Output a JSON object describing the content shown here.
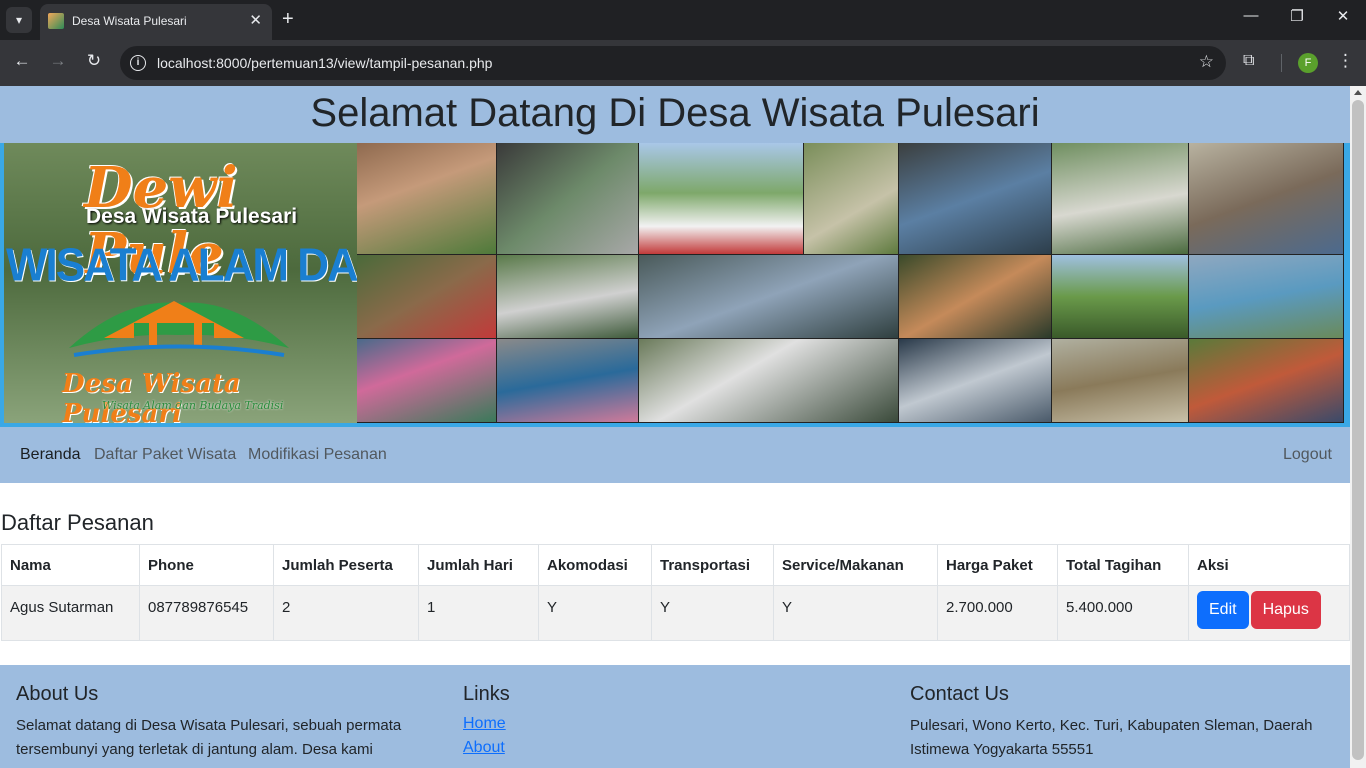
{
  "browser": {
    "tab_title": "Desa Wisata Pulesari",
    "tab_close": "✕",
    "new_tab": "+",
    "url": "localhost:8000/pertemuan13/view/tampil-pesanan.php",
    "profile_initial": "F",
    "icons": {
      "tab_menu": "chevron-down-icon",
      "back": "back-arrow-icon",
      "forward": "forward-arrow-icon",
      "reload": "reload-icon",
      "site_info": "info-icon",
      "bookmark": "star-icon",
      "extensions": "puzzle-icon",
      "menu": "kebab-icon",
      "minimize": "minimize-icon",
      "maximize": "restore-icon",
      "close": "close-icon"
    }
  },
  "page": {
    "title": "Selamat Datang Di Desa Wisata Pulesari",
    "banner": {
      "logo_script": "Dewi Pule",
      "logo_subtitle": "Desa Wisata Pulesari",
      "logo_banner": "WISATA ALAM DAN BUDAYA TRADISI",
      "logo_name": "Desa Wisata Pulesari",
      "logo_tagline": "Wisata Alam dan Budaya Tradisi"
    },
    "nav": {
      "items": [
        "Beranda",
        "Daftar Paket Wisata",
        "Modifikasi Pesanan"
      ],
      "logout": "Logout"
    },
    "orders": {
      "title": "Daftar Pesanan",
      "columns": [
        "Nama",
        "Phone",
        "Jumlah Peserta",
        "Jumlah Hari",
        "Akomodasi",
        "Transportasi",
        "Service/Makanan",
        "Harga Paket",
        "Total Tagihan",
        "Aksi"
      ],
      "rows": [
        {
          "nama": "Agus Sutarman",
          "phone": "087789876545",
          "jumlah_peserta": "2",
          "jumlah_hari": "1",
          "akomodasi": "Y",
          "transportasi": "Y",
          "service_makanan": "Y",
          "harga_paket": "2.700.000",
          "total_tagihan": "5.400.000",
          "edit_label": "Edit",
          "delete_label": "Hapus"
        }
      ]
    },
    "footer": {
      "about_title": "About Us",
      "about_text": "Selamat datang di Desa Wisata Pulesari, sebuah permata tersembunyi yang terletak di jantung alam. Desa kami",
      "links_title": "Links",
      "links": [
        "Home",
        "About"
      ],
      "contact_title": "Contact Us",
      "contact_text": "Pulesari, Wono Kerto, Kec. Turi, Kabupaten Sleman, Daerah Istimewa Yogyakarta 55551"
    }
  },
  "colors": {
    "header_bg": "#9dbcdf",
    "edit_button": "#0d6efd",
    "delete_button": "#dc3545",
    "link": "#0d6efd"
  }
}
